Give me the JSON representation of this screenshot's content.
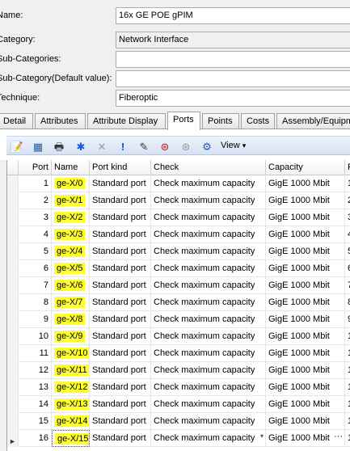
{
  "form": {
    "fields": [
      {
        "label": "Name:",
        "value": "16x GE POE gPIM",
        "style": "white"
      },
      {
        "label": "Category:",
        "value": "Network Interface",
        "style": "grey"
      },
      {
        "label": "Sub-Categories:",
        "value": "",
        "style": "white"
      },
      {
        "label": "Sub-Category(Default value):",
        "value": "",
        "style": "white"
      },
      {
        "label": "Technique:",
        "value": "Fiberoptic",
        "style": "white"
      }
    ]
  },
  "tabs": [
    {
      "label": "Detail",
      "active": false
    },
    {
      "label": "Attributes",
      "active": false
    },
    {
      "label": "Attribute Display",
      "active": false
    },
    {
      "label": "Ports",
      "active": true
    },
    {
      "label": "Points",
      "active": false
    },
    {
      "label": "Costs",
      "active": false
    },
    {
      "label": "Assembly/Equipment",
      "active": false
    }
  ],
  "toolbar": {
    "buttons": [
      {
        "icon": "edit-table-icon",
        "glyph": "📝"
      },
      {
        "icon": "table-properties-icon",
        "glyph": "▦"
      },
      {
        "icon": "print-icon",
        "glyph": "🖶"
      },
      {
        "icon": "asterisk-icon",
        "glyph": "✱"
      },
      {
        "icon": "delete-icon",
        "glyph": "✕"
      },
      {
        "icon": "exclamation-icon",
        "glyph": "!"
      },
      {
        "icon": "edit-pen-icon",
        "glyph": "✎"
      },
      {
        "icon": "gige-port-icon",
        "glyph": "⊛"
      },
      {
        "icon": "gige-port-disabled-icon",
        "glyph": "⊛"
      },
      {
        "icon": "port-settings-icon",
        "glyph": "⚙"
      }
    ],
    "view_label": "View",
    "view_arrow": "▾"
  },
  "grid": {
    "columns": [
      "",
      "Port",
      "Name",
      "Port kind",
      "Check",
      "Capacity",
      "P"
    ],
    "rows": [
      {
        "port": "1",
        "name": "ge-X/0",
        "kind": "Standard port",
        "check": "Check maximum capacity",
        "capacity": "GigE 1000 Mbit",
        "p": "1"
      },
      {
        "port": "2",
        "name": "ge-X/1",
        "kind": "Standard port",
        "check": "Check maximum capacity",
        "capacity": "GigE 1000 Mbit",
        "p": "2"
      },
      {
        "port": "3",
        "name": "ge-X/2",
        "kind": "Standard port",
        "check": "Check maximum capacity",
        "capacity": "GigE 1000 Mbit",
        "p": "3"
      },
      {
        "port": "4",
        "name": "ge-X/3",
        "kind": "Standard port",
        "check": "Check maximum capacity",
        "capacity": "GigE 1000 Mbit",
        "p": "4"
      },
      {
        "port": "5",
        "name": "ge-X/4",
        "kind": "Standard port",
        "check": "Check maximum capacity",
        "capacity": "GigE 1000 Mbit",
        "p": "5"
      },
      {
        "port": "6",
        "name": "ge-X/5",
        "kind": "Standard port",
        "check": "Check maximum capacity",
        "capacity": "GigE 1000 Mbit",
        "p": "6"
      },
      {
        "port": "7",
        "name": "ge-X/6",
        "kind": "Standard port",
        "check": "Check maximum capacity",
        "capacity": "GigE 1000 Mbit",
        "p": "7"
      },
      {
        "port": "8",
        "name": "ge-X/7",
        "kind": "Standard port",
        "check": "Check maximum capacity",
        "capacity": "GigE 1000 Mbit",
        "p": "8"
      },
      {
        "port": "9",
        "name": "ge-X/8",
        "kind": "Standard port",
        "check": "Check maximum capacity",
        "capacity": "GigE 1000 Mbit",
        "p": "9"
      },
      {
        "port": "10",
        "name": "ge-X/9",
        "kind": "Standard port",
        "check": "Check maximum capacity",
        "capacity": "GigE 1000 Mbit",
        "p": "1"
      },
      {
        "port": "11",
        "name": "ge-X/10",
        "kind": "Standard port",
        "check": "Check maximum capacity",
        "capacity": "GigE 1000 Mbit",
        "p": "1"
      },
      {
        "port": "12",
        "name": "ge-X/11",
        "kind": "Standard port",
        "check": "Check maximum capacity",
        "capacity": "GigE 1000 Mbit",
        "p": "1"
      },
      {
        "port": "13",
        "name": "ge-X/12",
        "kind": "Standard port",
        "check": "Check maximum capacity",
        "capacity": "GigE 1000 Mbit",
        "p": "1"
      },
      {
        "port": "14",
        "name": "ge-X/13",
        "kind": "Standard port",
        "check": "Check maximum capacity",
        "capacity": "GigE 1000 Mbit",
        "p": "1"
      },
      {
        "port": "15",
        "name": "ge-X/14",
        "kind": "Standard port",
        "check": "Check maximum capacity",
        "capacity": "GigE 1000 Mbit",
        "p": "1"
      },
      {
        "port": "16",
        "name": "ge-X/15",
        "kind": "Standard port",
        "check": "Check maximum capacity",
        "capacity": "GigE 1000 Mbit",
        "p": "1"
      }
    ],
    "active_row_ellipsis": "···",
    "active_row_arrow": "▾",
    "row_pointer": "►",
    "highlight_color": "#ffff33"
  }
}
